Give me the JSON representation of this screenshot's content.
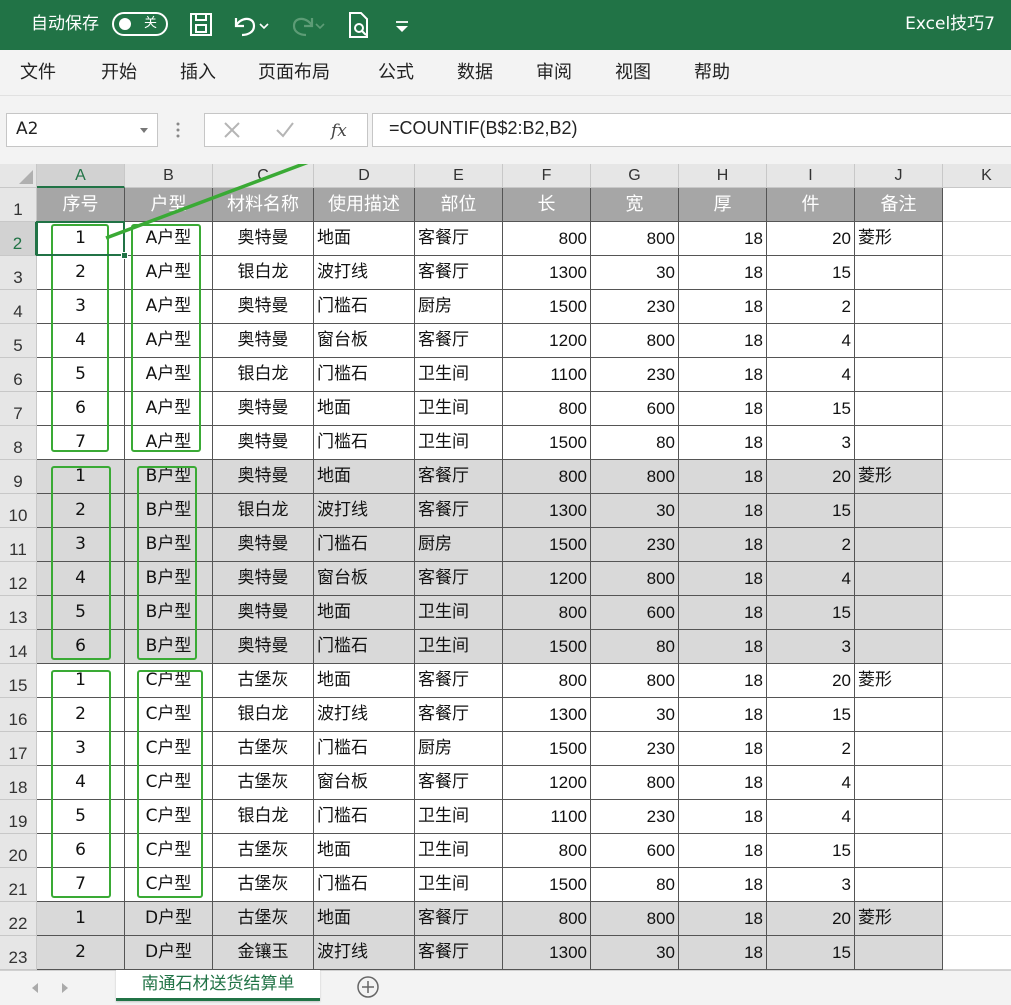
{
  "titlebar": {
    "autosave_label": "自动保存",
    "autosave_state": "关",
    "file_title": "Excel技巧7"
  },
  "ribbon": {
    "tabs": [
      "文件",
      "开始",
      "插入",
      "页面布局",
      "公式",
      "数据",
      "审阅",
      "视图",
      "帮助"
    ]
  },
  "formula_bar": {
    "name_box": "A2",
    "formula": "=COUNTIF(B$2:B2,B2)"
  },
  "grid": {
    "columns": [
      "A",
      "B",
      "C",
      "D",
      "E",
      "F",
      "G",
      "H",
      "I",
      "J",
      "K"
    ],
    "selected_cell": "A2",
    "rows": [
      {
        "n": "1",
        "cells": [
          "序号",
          "户型",
          "材料名称",
          "使用描述",
          "部位",
          "长",
          "宽",
          "厚",
          "件",
          "备注"
        ]
      },
      {
        "n": "2",
        "cells": [
          "1",
          "A户型",
          "奥特曼",
          "地面",
          "客餐厅",
          "800",
          "800",
          "18",
          "20",
          "菱形"
        ]
      },
      {
        "n": "3",
        "cells": [
          "2",
          "A户型",
          "银白龙",
          "波打线",
          "客餐厅",
          "1300",
          "30",
          "18",
          "15",
          ""
        ]
      },
      {
        "n": "4",
        "cells": [
          "3",
          "A户型",
          "奥特曼",
          "门槛石",
          "厨房",
          "1500",
          "230",
          "18",
          "2",
          ""
        ]
      },
      {
        "n": "5",
        "cells": [
          "4",
          "A户型",
          "奥特曼",
          "窗台板",
          "客餐厅",
          "1200",
          "800",
          "18",
          "4",
          ""
        ]
      },
      {
        "n": "6",
        "cells": [
          "5",
          "A户型",
          "银白龙",
          "门槛石",
          "卫生间",
          "1100",
          "230",
          "18",
          "4",
          ""
        ]
      },
      {
        "n": "7",
        "cells": [
          "6",
          "A户型",
          "奥特曼",
          "地面",
          "卫生间",
          "800",
          "600",
          "18",
          "15",
          ""
        ]
      },
      {
        "n": "8",
        "cells": [
          "7",
          "A户型",
          "奥特曼",
          "门槛石",
          "卫生间",
          "1500",
          "80",
          "18",
          "3",
          ""
        ]
      },
      {
        "n": "9",
        "cells": [
          "1",
          "B户型",
          "奥特曼",
          "地面",
          "客餐厅",
          "800",
          "800",
          "18",
          "20",
          "菱形"
        ]
      },
      {
        "n": "10",
        "cells": [
          "2",
          "B户型",
          "银白龙",
          "波打线",
          "客餐厅",
          "1300",
          "30",
          "18",
          "15",
          ""
        ]
      },
      {
        "n": "11",
        "cells": [
          "3",
          "B户型",
          "奥特曼",
          "门槛石",
          "厨房",
          "1500",
          "230",
          "18",
          "2",
          ""
        ]
      },
      {
        "n": "12",
        "cells": [
          "4",
          "B户型",
          "奥特曼",
          "窗台板",
          "客餐厅",
          "1200",
          "800",
          "18",
          "4",
          ""
        ]
      },
      {
        "n": "13",
        "cells": [
          "5",
          "B户型",
          "奥特曼",
          "地面",
          "卫生间",
          "800",
          "600",
          "18",
          "15",
          ""
        ]
      },
      {
        "n": "14",
        "cells": [
          "6",
          "B户型",
          "奥特曼",
          "门槛石",
          "卫生间",
          "1500",
          "80",
          "18",
          "3",
          ""
        ]
      },
      {
        "n": "15",
        "cells": [
          "1",
          "C户型",
          "古堡灰",
          "地面",
          "客餐厅",
          "800",
          "800",
          "18",
          "20",
          "菱形"
        ]
      },
      {
        "n": "16",
        "cells": [
          "2",
          "C户型",
          "银白龙",
          "波打线",
          "客餐厅",
          "1300",
          "30",
          "18",
          "15",
          ""
        ]
      },
      {
        "n": "17",
        "cells": [
          "3",
          "C户型",
          "古堡灰",
          "门槛石",
          "厨房",
          "1500",
          "230",
          "18",
          "2",
          ""
        ]
      },
      {
        "n": "18",
        "cells": [
          "4",
          "C户型",
          "古堡灰",
          "窗台板",
          "客餐厅",
          "1200",
          "800",
          "18",
          "4",
          ""
        ]
      },
      {
        "n": "19",
        "cells": [
          "5",
          "C户型",
          "银白龙",
          "门槛石",
          "卫生间",
          "1100",
          "230",
          "18",
          "4",
          ""
        ]
      },
      {
        "n": "20",
        "cells": [
          "6",
          "C户型",
          "古堡灰",
          "地面",
          "卫生间",
          "800",
          "600",
          "18",
          "15",
          ""
        ]
      },
      {
        "n": "21",
        "cells": [
          "7",
          "C户型",
          "古堡灰",
          "门槛石",
          "卫生间",
          "1500",
          "80",
          "18",
          "3",
          ""
        ]
      },
      {
        "n": "22",
        "cells": [
          "1",
          "D户型",
          "古堡灰",
          "地面",
          "客餐厅",
          "800",
          "800",
          "18",
          "20",
          "菱形"
        ]
      },
      {
        "n": "23",
        "cells": [
          "2",
          "D户型",
          "金镶玉",
          "波打线",
          "客餐厅",
          "1300",
          "30",
          "18",
          "15",
          ""
        ]
      }
    ]
  },
  "sheet_tabs": {
    "active": "南通石材送货结算单"
  },
  "colors": {
    "brand": "#217346",
    "header_fill": "#a6a6a6",
    "shade_fill": "#d9d9d9",
    "annotation": "#3aaa35"
  }
}
